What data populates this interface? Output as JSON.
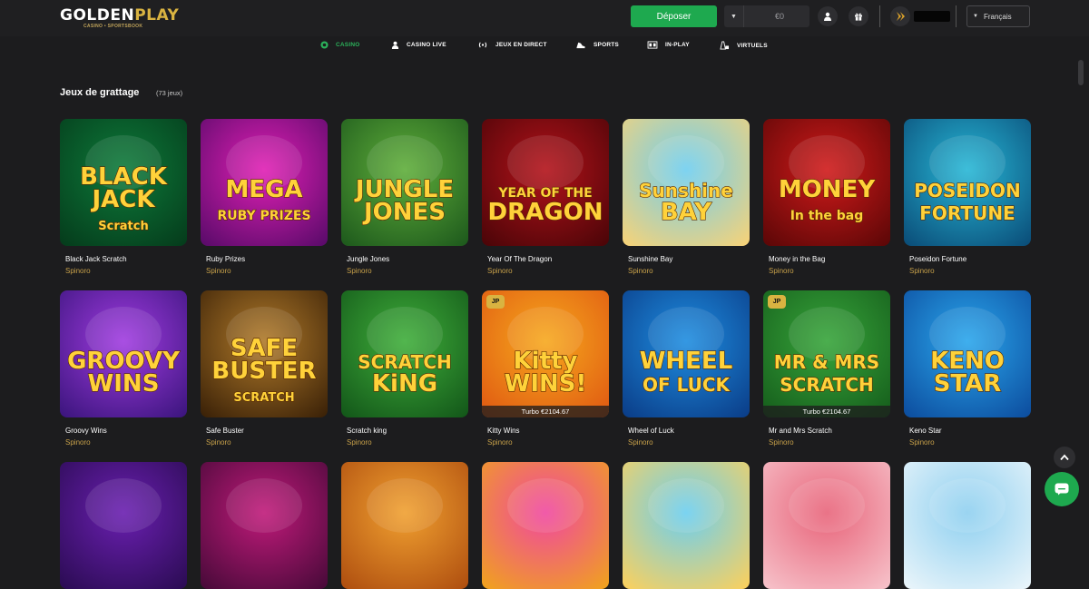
{
  "header": {
    "logo": {
      "part1": "GOLDEN",
      "part2": "PLAY",
      "tagline": "CASINO • SPORTSBOOK"
    },
    "deposit_label": "Déposer",
    "balance": "€0",
    "language": "Français"
  },
  "nav": [
    {
      "label": "CASINO",
      "icon": "casino-chip-icon",
      "active": true
    },
    {
      "label": "CASINO LIVE",
      "icon": "dealer-icon",
      "active": false
    },
    {
      "label": "JEUX EN DIRECT",
      "icon": "broadcast-icon",
      "active": false
    },
    {
      "label": "SPORTS",
      "icon": "sneaker-icon",
      "active": false
    },
    {
      "label": "IN-PLAY",
      "icon": "scoreboard-icon",
      "active": false
    },
    {
      "label": "VIRTUELS",
      "icon": "virtual-icon",
      "active": false
    }
  ],
  "section": {
    "title": "Jeux de grattage",
    "count": "(73 jeux)"
  },
  "games": [
    {
      "name": "Black Jack Scratch",
      "provider": "Spinoro",
      "art": [
        "BLACK",
        "JACK",
        "Scratch"
      ],
      "colors": [
        "#0d7a3a",
        "#053d1c"
      ]
    },
    {
      "name": "Ruby Prizes",
      "provider": "Spinoro",
      "art": [
        "MEGA",
        "RUBY PRIZES"
      ],
      "colors": [
        "#e01fb4",
        "#5c0b6b"
      ]
    },
    {
      "name": "Jungle Jones",
      "provider": "Spinoro",
      "art": [
        "JUNGLE",
        "JONES"
      ],
      "colors": [
        "#5fae3a",
        "#1f5b1d"
      ]
    },
    {
      "name": "Year Of The Dragon",
      "provider": "Spinoro",
      "art": [
        "YEAR OF THE",
        "DRAGON"
      ],
      "colors": [
        "#b3121a",
        "#4d0508"
      ]
    },
    {
      "name": "Sunshine Bay",
      "provider": "Spinoro",
      "art": [
        "Sunshine",
        "BAY"
      ],
      "colors": [
        "#6fcff0",
        "#f4d27a"
      ]
    },
    {
      "name": "Money in the Bag",
      "provider": "Spinoro",
      "art": [
        "MONEY",
        "In the bag"
      ],
      "colors": [
        "#d01a1a",
        "#5e0707"
      ]
    },
    {
      "name": "Poseidon Fortune",
      "provider": "Spinoro",
      "art": [
        "POSEIDON",
        "FORTUNE"
      ],
      "colors": [
        "#27b7d6",
        "#0b4f7a"
      ]
    },
    {
      "name": "Groovy Wins",
      "provider": "Spinoro",
      "art": [
        "GROOVY",
        "WINS"
      ],
      "colors": [
        "#a03be0",
        "#3e1680"
      ]
    },
    {
      "name": "Safe Buster",
      "provider": "Spinoro",
      "art": [
        "SAFE",
        "BUSTER",
        "SCRATCH"
      ],
      "colors": [
        "#b07a2a",
        "#3d2308"
      ]
    },
    {
      "name": "Scratch king",
      "provider": "Spinoro",
      "art": [
        "SCRATCH",
        "KiNG"
      ],
      "colors": [
        "#3fae3a",
        "#14591a"
      ]
    },
    {
      "name": "Kitty Wins",
      "provider": "Spinoro",
      "art": [
        "Kitty",
        "WINS!"
      ],
      "colors": [
        "#f6a81d",
        "#e05a12"
      ],
      "jp": "JP",
      "jackpot": "Turbo €2104.67"
    },
    {
      "name": "Wheel of Luck",
      "provider": "Spinoro",
      "art": [
        "WHEEL",
        "OF LUCK"
      ],
      "colors": [
        "#1e8de0",
        "#0b3f8a"
      ]
    },
    {
      "name": "Mr and Mrs Scratch",
      "provider": "Spinoro",
      "art": [
        "MR & MRS",
        "SCRATCH"
      ],
      "colors": [
        "#37a53a",
        "#165e1c"
      ],
      "jp": "JP",
      "jackpot": "Turbo €2104.67"
    },
    {
      "name": "Keno Star",
      "provider": "Spinoro",
      "art": [
        "KENO",
        "STAR"
      ],
      "colors": [
        "#2aa6ec",
        "#0d4fa0"
      ]
    },
    {
      "name": "",
      "provider": "",
      "art": [],
      "colors": [
        "#6a1fb0",
        "#2c0c55"
      ]
    },
    {
      "name": "",
      "provider": "",
      "art": [],
      "colors": [
        "#c01a7a",
        "#4a0a3a"
      ]
    },
    {
      "name": "",
      "provider": "",
      "art": [],
      "colors": [
        "#f0a030",
        "#b05010"
      ]
    },
    {
      "name": "",
      "provider": "",
      "art": [],
      "colors": [
        "#f048a0",
        "#f0a020"
      ]
    },
    {
      "name": "",
      "provider": "",
      "art": [],
      "colors": [
        "#6ccff0",
        "#f8d060"
      ]
    },
    {
      "name": "",
      "provider": "",
      "art": [],
      "colors": [
        "#e8647a",
        "#f6c0c8"
      ]
    },
    {
      "name": "",
      "provider": "",
      "art": [],
      "colors": [
        "#8fd0f0",
        "#e8f4fa"
      ]
    }
  ]
}
